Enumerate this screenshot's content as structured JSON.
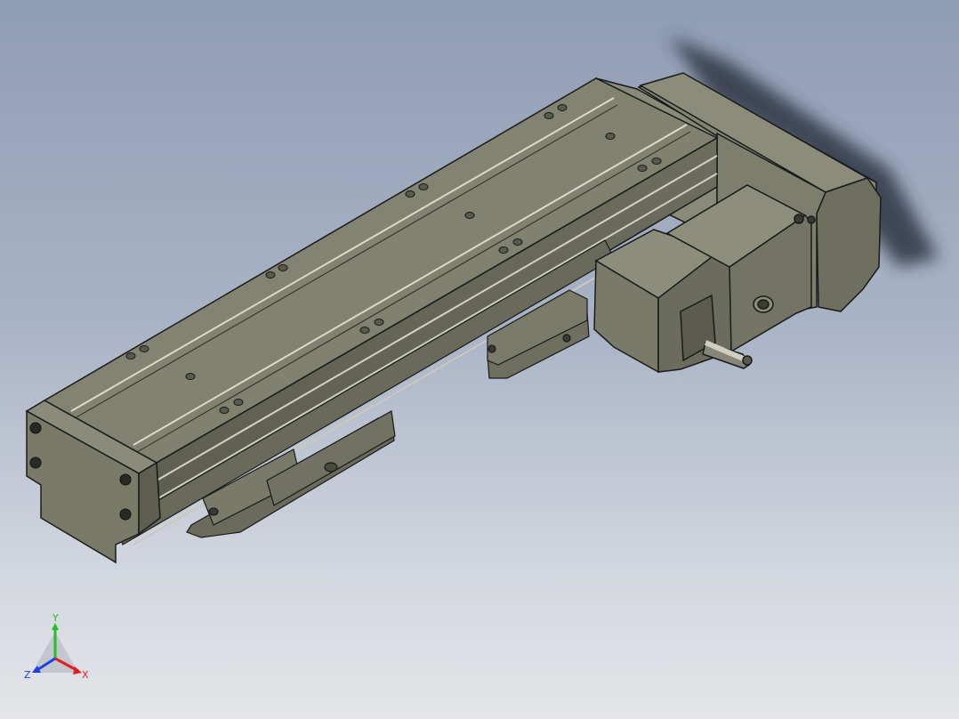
{
  "viewport": {
    "background_top": "#8f9db3",
    "background_bottom": "#e4e5e8"
  },
  "model": {
    "body_color": "#7b7b6b",
    "body_light": "#9a9a88",
    "body_dark": "#55554a",
    "edge_color": "#1a1a1a",
    "shadow_color": "#2e3545"
  },
  "triad": {
    "x_label": "X",
    "y_label": "Y",
    "z_label": "Z",
    "x_color": "#e02020",
    "y_color": "#22c022",
    "z_color": "#2040e0"
  }
}
